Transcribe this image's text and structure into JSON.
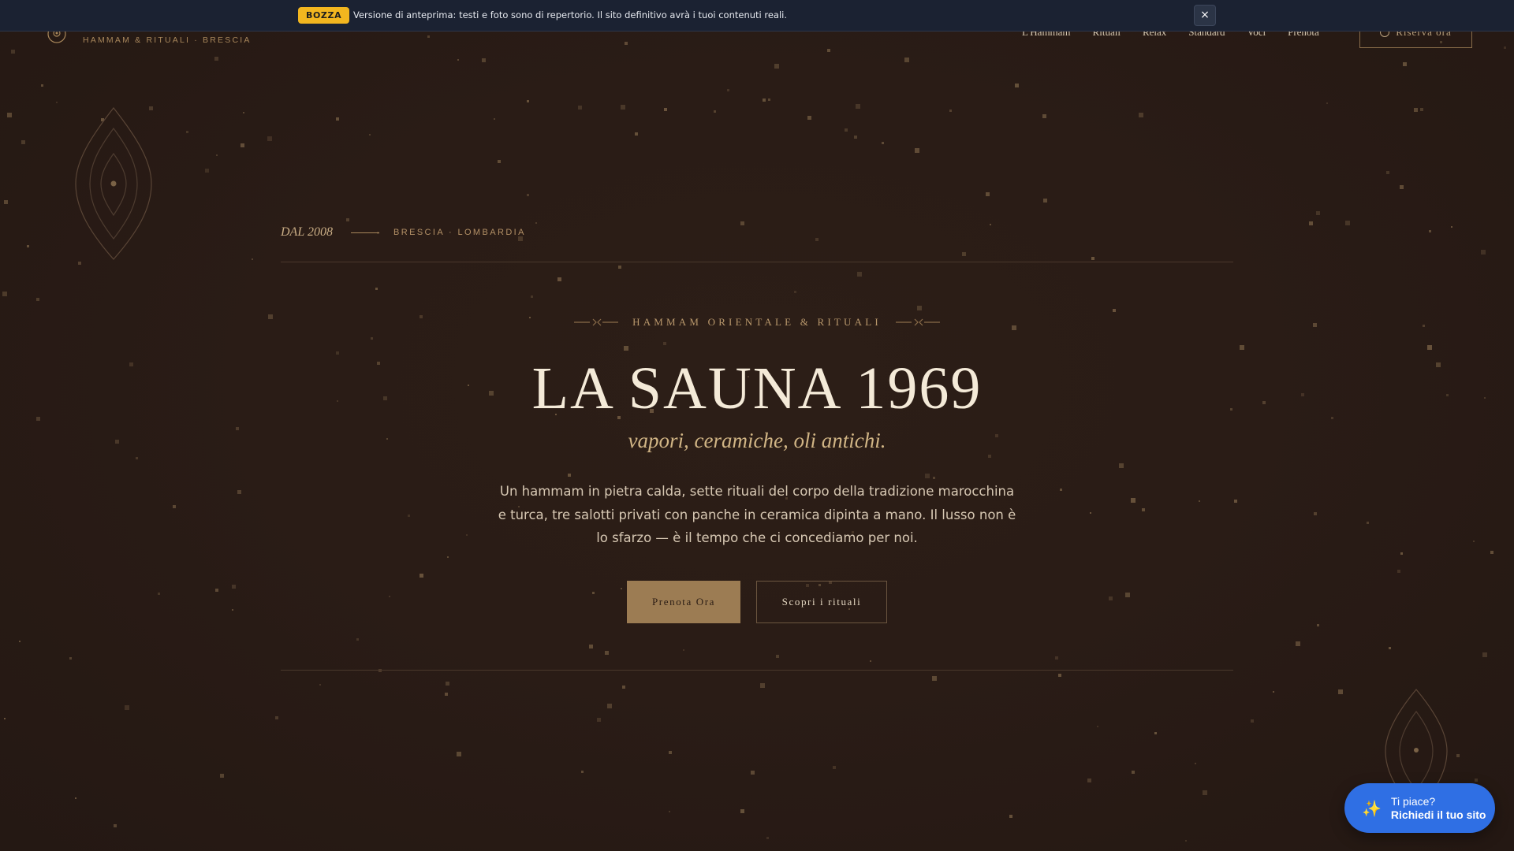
{
  "preview_banner": {
    "badge": "BOZZA",
    "message": "Versione di anteprima: testi e foto sono di repertorio. Il sito definitivo avrà i tuoi contenuti reali.",
    "close_label": "×"
  },
  "header": {
    "logo_subtitle": "HAMMAM & RITUALI · BRESCIA",
    "nav": [
      "L'Hammam",
      "Rituali",
      "Relax",
      "Standard",
      "Voci",
      "Prenota"
    ],
    "reserve_label": "Riserva ora"
  },
  "hero": {
    "since": "DAL 2008",
    "location": "BRESCIA · LOMBARDIA",
    "eyebrow": "HAMMAM ORIENTALE & RITUALI",
    "title": "LA SAUNA 1969",
    "tagline": "vapori, ceramiche, oli antichi.",
    "description": "Un hammam in pietra calda, sette rituali del corpo della tradizione marocchina e turca, tre salotti privati con panche in ceramica dipinta a mano. Il lusso non è lo sfarzo — è il tempo che ci concediamo per noi.",
    "primary_cta": "Prenota Ora",
    "secondary_cta": "Scopri i rituali"
  },
  "floating_cta": {
    "icon": "sparkles-icon",
    "line1": "Ti piace?",
    "line2": "Richiedi il tuo sito"
  },
  "colors": {
    "background": "#2a1c16",
    "gold": "#b9986c",
    "primary_button": "#9c7c53",
    "banner": "#1b2232",
    "badge": "#f2b61f",
    "cta_blue": "#2f6fe4"
  }
}
